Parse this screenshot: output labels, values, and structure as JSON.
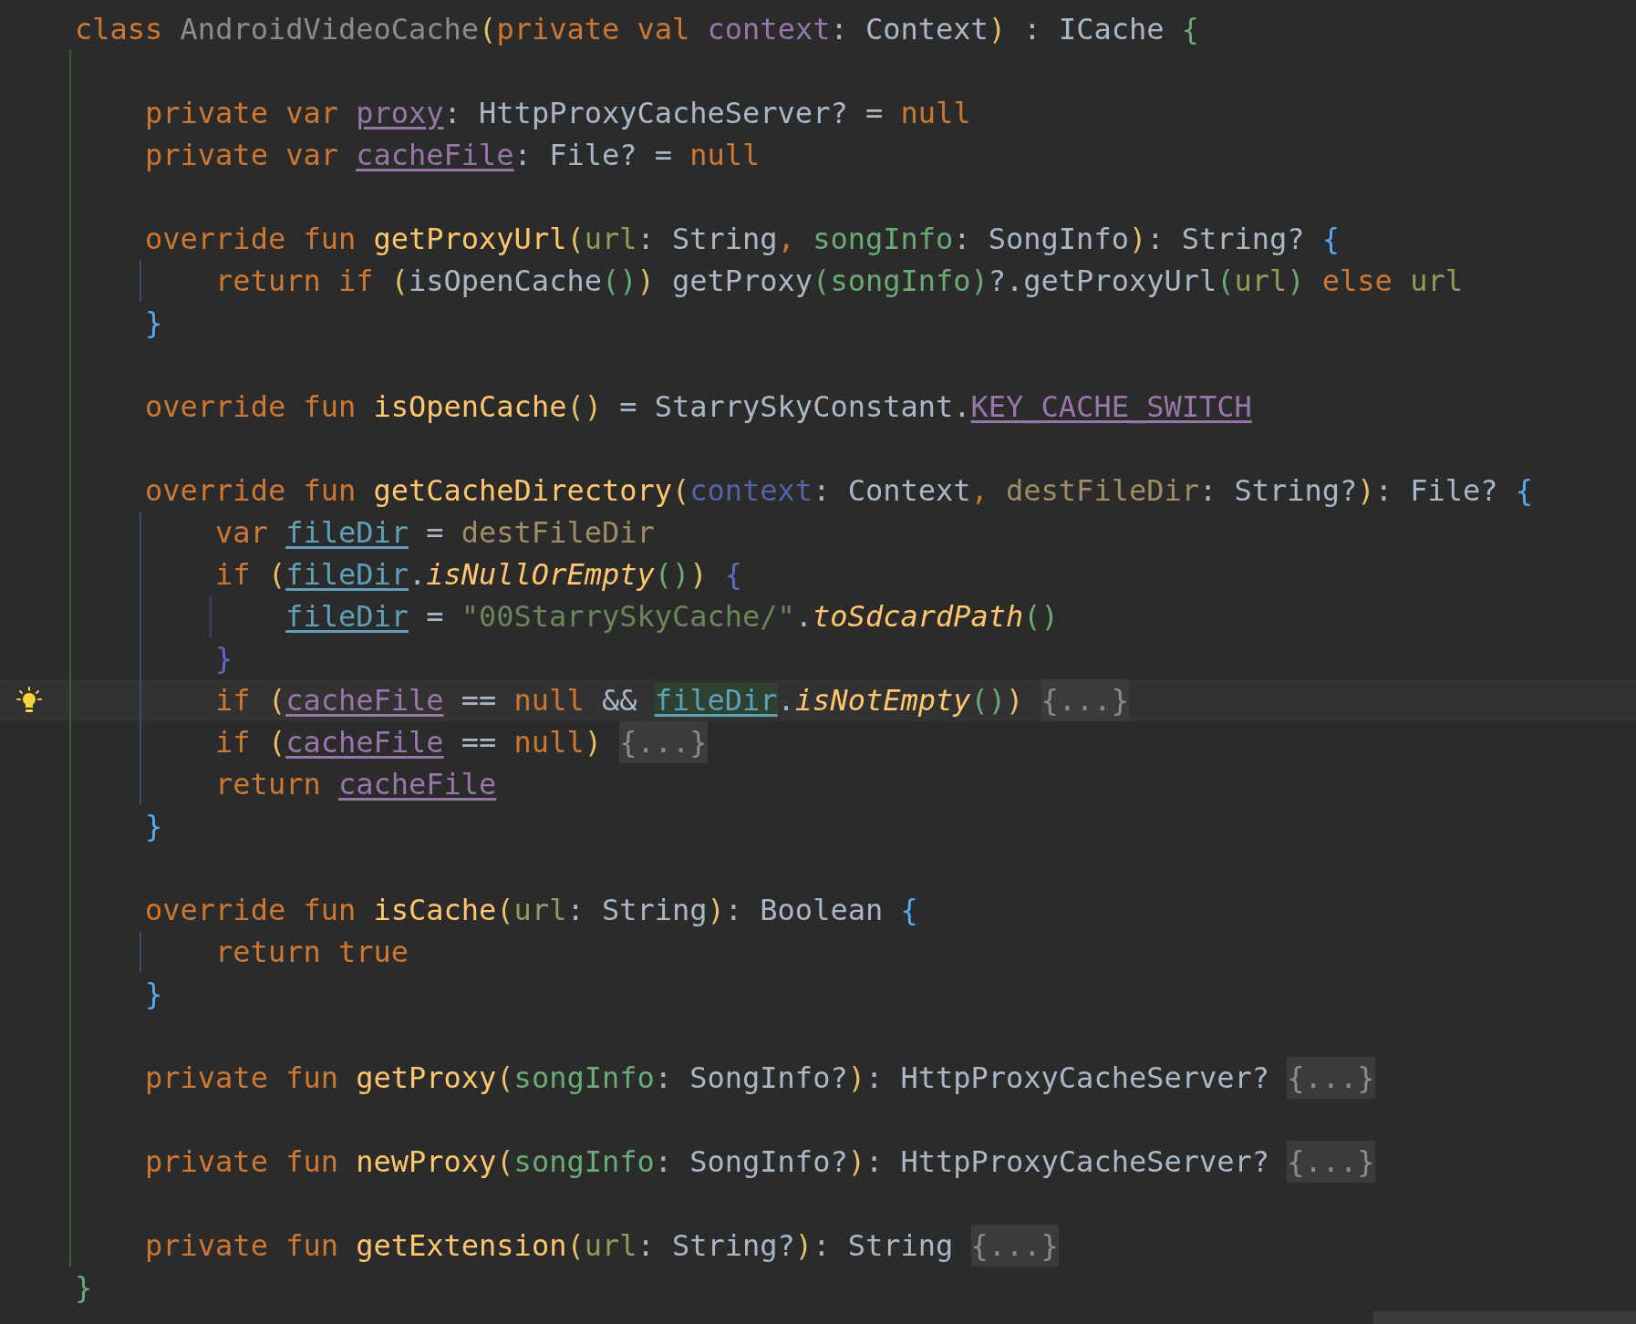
{
  "editor": {
    "lines": [
      {
        "kind": "code",
        "current": false,
        "tokens": [
          {
            "kind": "keyword",
            "text": "class "
          },
          {
            "kind": "classname",
            "text": "AndroidVideoCache"
          },
          {
            "kind": "paren",
            "text": "("
          },
          {
            "kind": "keyword",
            "text": "private val "
          },
          {
            "kind": "field",
            "text": "context"
          },
          {
            "kind": "plain",
            "text": ": Context"
          },
          {
            "kind": "paren",
            "text": ")"
          },
          {
            "kind": "plain",
            "text": " : ICache "
          },
          {
            "kind": "outer",
            "text": "{"
          }
        ],
        "children": [
          {
            "kind": "blank",
            "current": false
          },
          {
            "kind": "code",
            "current": false,
            "tokens": [
              {
                "kind": "keyword",
                "text": "private var "
              },
              {
                "kind": "property",
                "text": "proxy"
              },
              {
                "kind": "plain",
                "text": ": HttpProxyCacheServer? = "
              },
              {
                "kind": "keyword",
                "text": "null"
              }
            ]
          },
          {
            "kind": "code",
            "current": false,
            "tokens": [
              {
                "kind": "keyword",
                "text": "private var "
              },
              {
                "kind": "property",
                "text": "cacheFile"
              },
              {
                "kind": "plain",
                "text": ": File? = "
              },
              {
                "kind": "keyword",
                "text": "null"
              }
            ]
          },
          {
            "kind": "blank",
            "current": false
          },
          {
            "kind": "code",
            "current": false,
            "tokens": [
              {
                "kind": "keyword",
                "text": "override fun "
              },
              {
                "kind": "function",
                "text": "getProxyUrl"
              },
              {
                "kind": "paren",
                "text": "("
              },
              {
                "kind": "param",
                "text": "url"
              },
              {
                "kind": "plain",
                "text": ": String"
              },
              {
                "kind": "keyword",
                "text": ", "
              },
              {
                "kind": "arg",
                "text": "songInfo"
              },
              {
                "kind": "plain",
                "text": ": SongInfo"
              },
              {
                "kind": "paren",
                "text": ")"
              },
              {
                "kind": "plain",
                "text": ": String? "
              },
              {
                "kind": "brace",
                "text": "{"
              }
            ],
            "children": [
              {
                "kind": "code",
                "current": false,
                "tokens": [
                  {
                    "kind": "keyword",
                    "text": "return if "
                  },
                  {
                    "kind": "paren",
                    "text": "("
                  },
                  {
                    "kind": "plain",
                    "text": "isOpenCache"
                  },
                  {
                    "kind": "inner",
                    "text": "()"
                  },
                  {
                    "kind": "paren",
                    "text": ")"
                  },
                  {
                    "kind": "plain",
                    "text": " getProxy"
                  },
                  {
                    "kind": "inner",
                    "text": "("
                  },
                  {
                    "kind": "arg",
                    "text": "songInfo"
                  },
                  {
                    "kind": "inner",
                    "text": ")"
                  },
                  {
                    "kind": "plain",
                    "text": "?.getProxyUrl"
                  },
                  {
                    "kind": "inner",
                    "text": "("
                  },
                  {
                    "kind": "param",
                    "text": "url"
                  },
                  {
                    "kind": "inner",
                    "text": ")"
                  },
                  {
                    "kind": "keyword",
                    "text": " else "
                  },
                  {
                    "kind": "param",
                    "text": "url"
                  }
                ]
              }
            ]
          },
          {
            "kind": "code",
            "current": false,
            "tokens": [
              {
                "kind": "brace",
                "text": "}"
              }
            ]
          },
          {
            "kind": "blank",
            "current": false
          },
          {
            "kind": "code",
            "current": false,
            "tokens": [
              {
                "kind": "keyword",
                "text": "override fun "
              },
              {
                "kind": "function",
                "text": "isOpenCache"
              },
              {
                "kind": "paren",
                "text": "()"
              },
              {
                "kind": "plain",
                "text": " = StarrySkyConstant."
              },
              {
                "kind": "property",
                "text": "KEY_CACHE_SWITCH"
              }
            ]
          },
          {
            "kind": "blank",
            "current": false
          },
          {
            "kind": "code",
            "current": false,
            "tokens": [
              {
                "kind": "keyword",
                "text": "override fun "
              },
              {
                "kind": "function",
                "text": "getCacheDirectory"
              },
              {
                "kind": "paren",
                "text": "("
              },
              {
                "kind": "unused",
                "text": "context"
              },
              {
                "kind": "plain",
                "text": ": Context"
              },
              {
                "kind": "keyword",
                "text": ", "
              },
              {
                "kind": "dest",
                "text": "destFileDir"
              },
              {
                "kind": "plain",
                "text": ": String?"
              },
              {
                "kind": "paren",
                "text": ")"
              },
              {
                "kind": "plain",
                "text": ": File? "
              },
              {
                "kind": "brace",
                "text": "{"
              }
            ],
            "children": [
              {
                "kind": "code",
                "current": false,
                "tokens": [
                  {
                    "kind": "keyword",
                    "text": "var "
                  },
                  {
                    "kind": "local",
                    "text": "fileDir"
                  },
                  {
                    "kind": "plain",
                    "text": " = "
                  },
                  {
                    "kind": "dest",
                    "text": "destFileDir"
                  }
                ]
              },
              {
                "kind": "code",
                "current": false,
                "tokens": [
                  {
                    "kind": "keyword",
                    "text": "if "
                  },
                  {
                    "kind": "paren",
                    "text": "("
                  },
                  {
                    "kind": "local",
                    "text": "fileDir"
                  },
                  {
                    "kind": "plain",
                    "text": "."
                  },
                  {
                    "kind": "extension",
                    "text": "isNullOrEmpty"
                  },
                  {
                    "kind": "inner",
                    "text": "()"
                  },
                  {
                    "kind": "paren",
                    "text": ") "
                  },
                  {
                    "kind": "block",
                    "text": "{"
                  }
                ],
                "children": [
                  {
                    "kind": "code",
                    "current": false,
                    "tokens": [
                      {
                        "kind": "local",
                        "text": "fileDir"
                      },
                      {
                        "kind": "plain",
                        "text": " = "
                      },
                      {
                        "kind": "string",
                        "text": "\"00StarrySkyCache/\""
                      },
                      {
                        "kind": "plain",
                        "text": "."
                      },
                      {
                        "kind": "extension",
                        "text": "toSdcardPath"
                      },
                      {
                        "kind": "inner",
                        "text": "()"
                      }
                    ]
                  }
                ]
              },
              {
                "kind": "code",
                "current": false,
                "tokens": [
                  {
                    "kind": "block",
                    "text": "}"
                  }
                ]
              },
              {
                "kind": "code",
                "current": true,
                "tokens": [
                  {
                    "kind": "keyword",
                    "text": "if "
                  },
                  {
                    "kind": "paren",
                    "text": "("
                  },
                  {
                    "kind": "property",
                    "text": "cacheFile"
                  },
                  {
                    "kind": "plain",
                    "text": " == "
                  },
                  {
                    "kind": "keyword",
                    "text": "null"
                  },
                  {
                    "kind": "plain",
                    "text": " && "
                  },
                  {
                    "kind": "match",
                    "text": "fileDir"
                  },
                  {
                    "kind": "plain",
                    "text": "."
                  },
                  {
                    "kind": "extension",
                    "text": "isNotEmpty"
                  },
                  {
                    "kind": "inner",
                    "text": "()"
                  },
                  {
                    "kind": "paren",
                    "text": ") "
                  },
                  {
                    "kind": "fold",
                    "text": "{...}"
                  }
                ]
              },
              {
                "kind": "code",
                "current": false,
                "tokens": [
                  {
                    "kind": "keyword",
                    "text": "if "
                  },
                  {
                    "kind": "paren",
                    "text": "("
                  },
                  {
                    "kind": "property",
                    "text": "cacheFile"
                  },
                  {
                    "kind": "plain",
                    "text": " == "
                  },
                  {
                    "kind": "keyword",
                    "text": "null"
                  },
                  {
                    "kind": "paren",
                    "text": ") "
                  },
                  {
                    "kind": "fold",
                    "text": "{...}"
                  }
                ]
              },
              {
                "kind": "code",
                "current": false,
                "tokens": [
                  {
                    "kind": "keyword",
                    "text": "return "
                  },
                  {
                    "kind": "property",
                    "text": "cacheFile"
                  }
                ]
              }
            ]
          },
          {
            "kind": "code",
            "current": false,
            "tokens": [
              {
                "kind": "brace",
                "text": "}"
              }
            ]
          },
          {
            "kind": "blank",
            "current": false
          },
          {
            "kind": "code",
            "current": false,
            "tokens": [
              {
                "kind": "keyword",
                "text": "override fun "
              },
              {
                "kind": "function",
                "text": "isCache"
              },
              {
                "kind": "paren",
                "text": "("
              },
              {
                "kind": "param",
                "text": "url"
              },
              {
                "kind": "plain",
                "text": ": String"
              },
              {
                "kind": "paren",
                "text": ")"
              },
              {
                "kind": "plain",
                "text": ": Boolean "
              },
              {
                "kind": "brace",
                "text": "{"
              }
            ],
            "children": [
              {
                "kind": "code",
                "current": false,
                "tokens": [
                  {
                    "kind": "keyword",
                    "text": "return true"
                  }
                ]
              }
            ]
          },
          {
            "kind": "code",
            "current": false,
            "tokens": [
              {
                "kind": "brace",
                "text": "}"
              }
            ]
          },
          {
            "kind": "blank",
            "current": false
          },
          {
            "kind": "code",
            "current": false,
            "tokens": [
              {
                "kind": "keyword",
                "text": "private fun "
              },
              {
                "kind": "function",
                "text": "getProxy"
              },
              {
                "kind": "paren",
                "text": "("
              },
              {
                "kind": "arg",
                "text": "songInfo"
              },
              {
                "kind": "plain",
                "text": ": SongInfo?"
              },
              {
                "kind": "paren",
                "text": ")"
              },
              {
                "kind": "plain",
                "text": ": HttpProxyCacheServer? "
              },
              {
                "kind": "fold",
                "text": "{...}"
              }
            ]
          },
          {
            "kind": "blank",
            "current": false
          },
          {
            "kind": "code",
            "current": false,
            "tokens": [
              {
                "kind": "keyword",
                "text": "private fun "
              },
              {
                "kind": "function",
                "text": "newProxy"
              },
              {
                "kind": "paren",
                "text": "("
              },
              {
                "kind": "arg",
                "text": "songInfo"
              },
              {
                "kind": "plain",
                "text": ": SongInfo?"
              },
              {
                "kind": "paren",
                "text": ")"
              },
              {
                "kind": "plain",
                "text": ": HttpProxyCacheServer? "
              },
              {
                "kind": "fold",
                "text": "{...}"
              }
            ]
          },
          {
            "kind": "blank",
            "current": false
          },
          {
            "kind": "code",
            "current": false,
            "tokens": [
              {
                "kind": "keyword",
                "text": "private fun "
              },
              {
                "kind": "function",
                "text": "getExtension"
              },
              {
                "kind": "paren",
                "text": "("
              },
              {
                "kind": "param",
                "text": "url"
              },
              {
                "kind": "plain",
                "text": ": String?"
              },
              {
                "kind": "paren",
                "text": ")"
              },
              {
                "kind": "plain",
                "text": ": String "
              },
              {
                "kind": "fold",
                "text": "{...}"
              }
            ]
          }
        ]
      },
      {
        "kind": "code",
        "current": false,
        "tokens": [
          {
            "kind": "outer",
            "text": "}"
          }
        ]
      }
    ]
  }
}
